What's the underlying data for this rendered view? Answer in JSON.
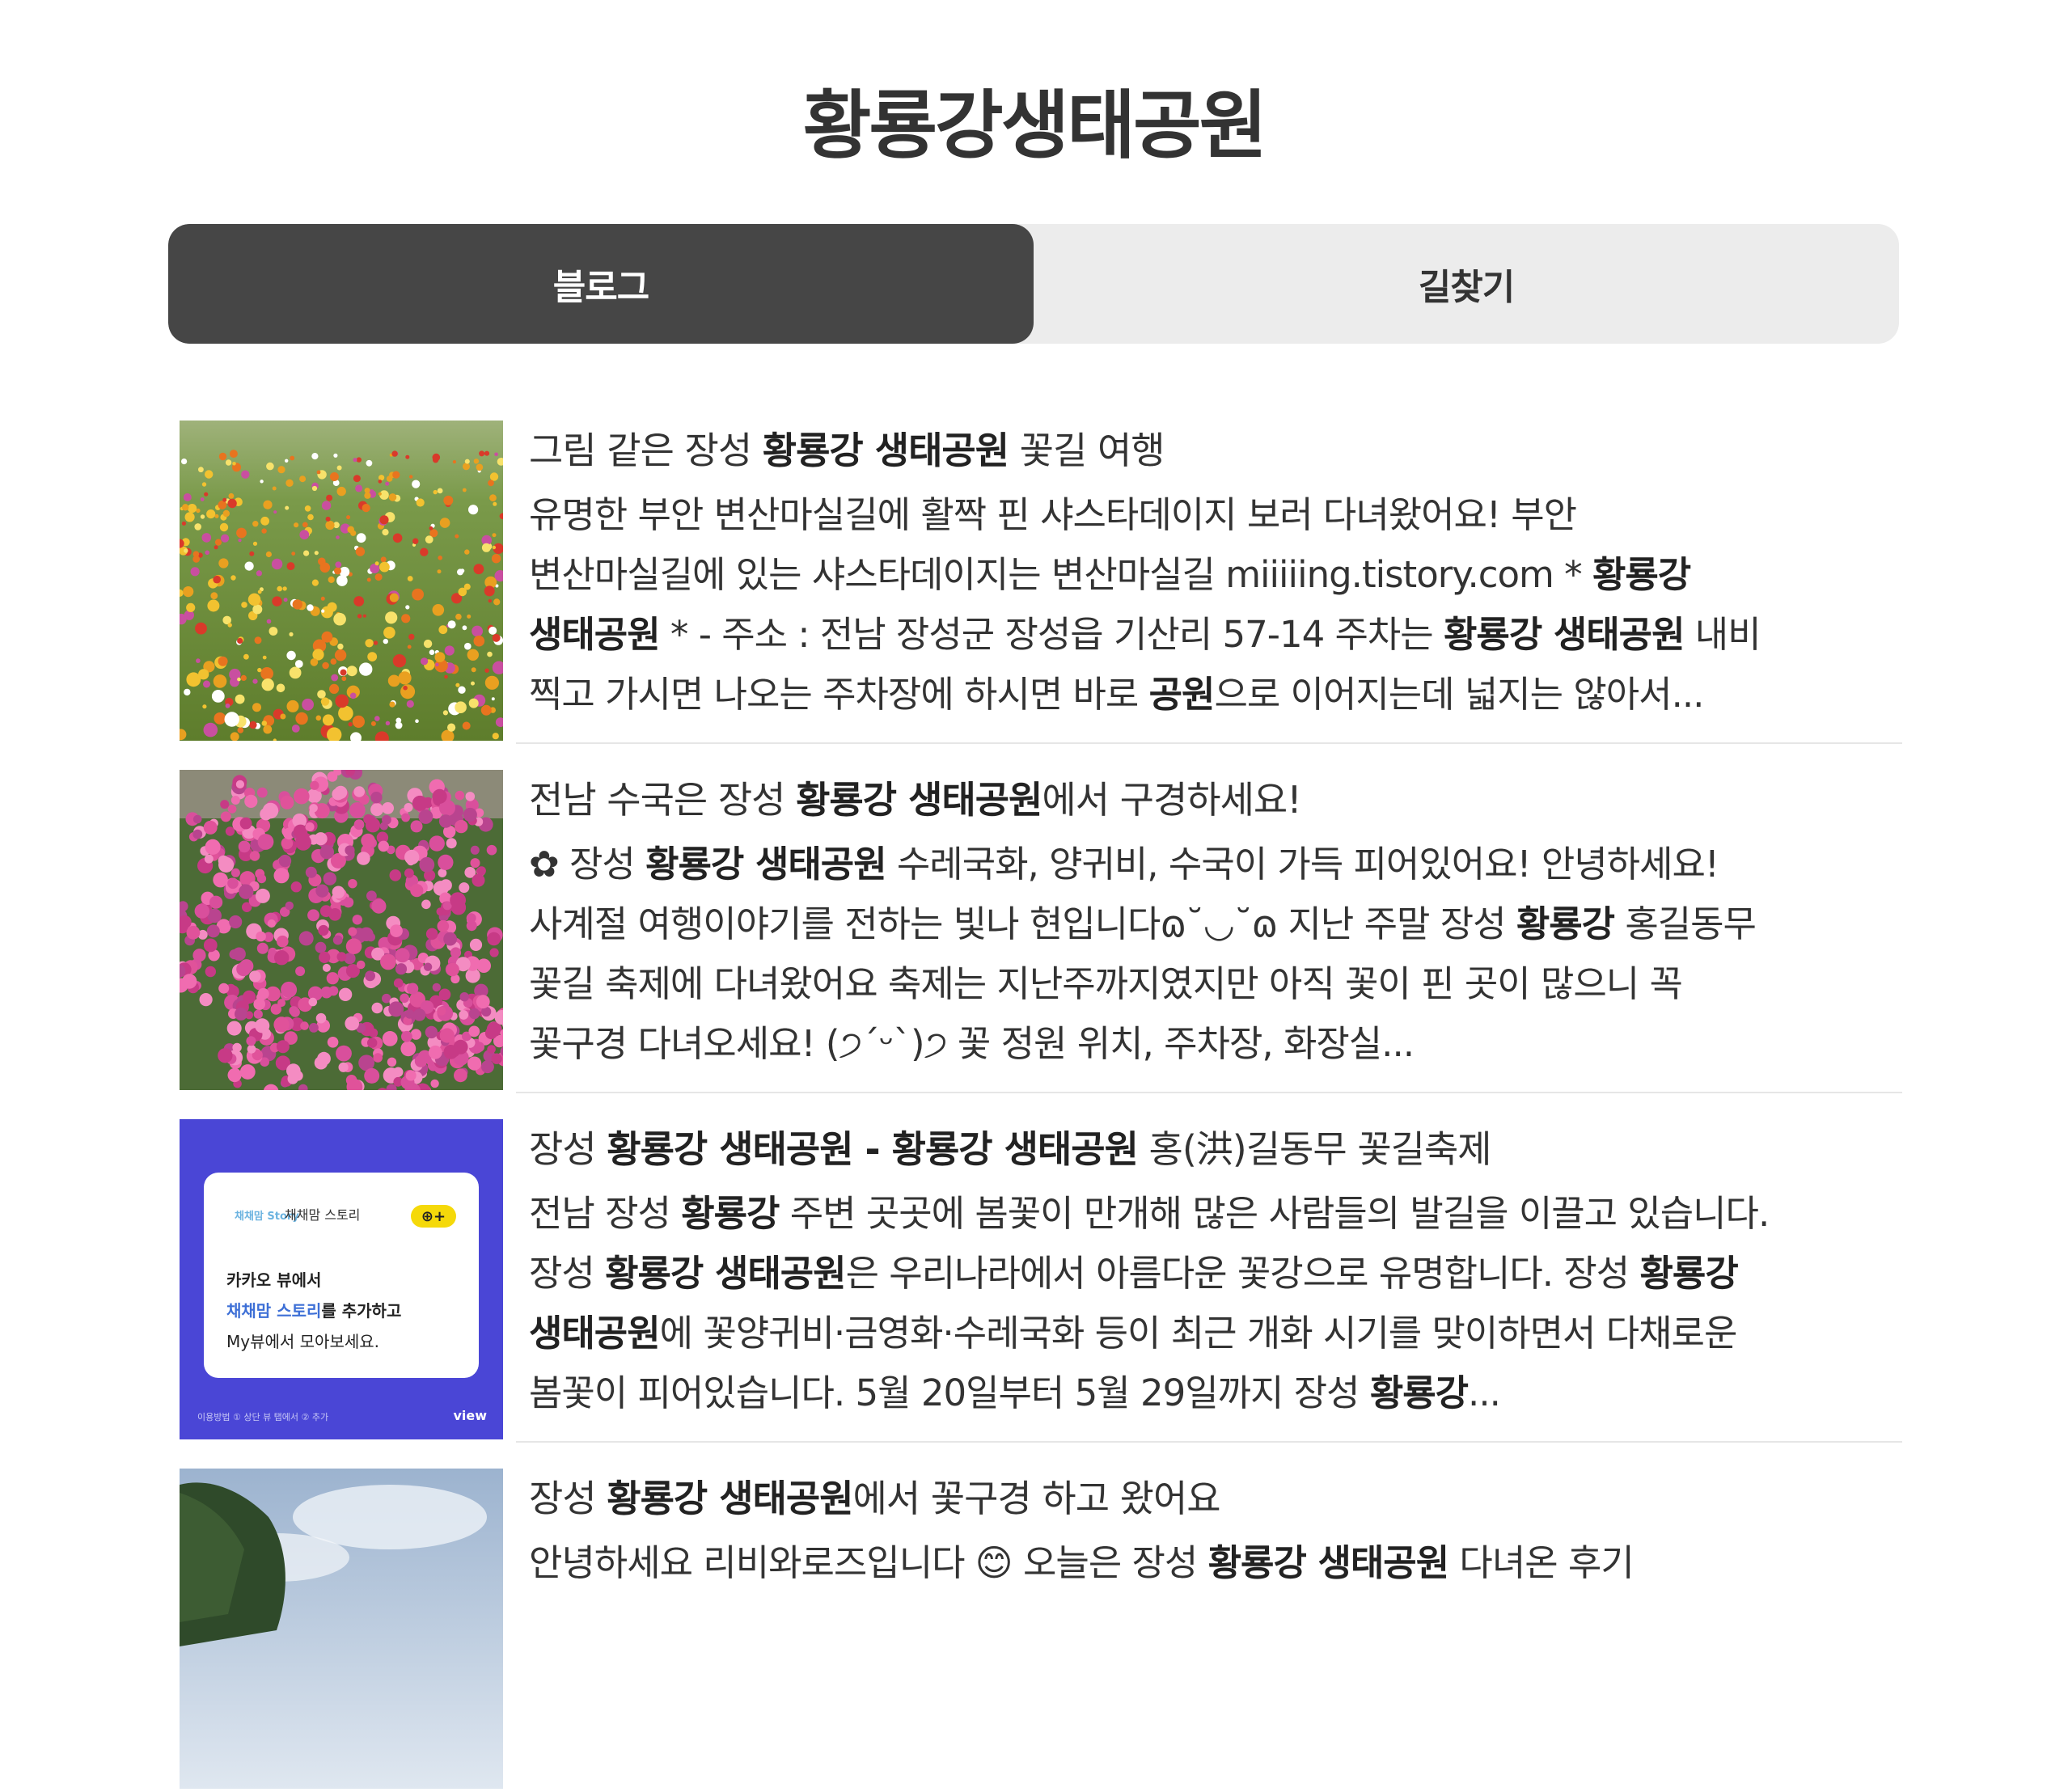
{
  "page": {
    "title": "황룡강생태공원"
  },
  "tabs": [
    {
      "label": "블로그",
      "active": true
    },
    {
      "label": "길찾기",
      "active": false
    }
  ],
  "results": [
    {
      "image": "flower-meadow-photo",
      "title": [
        {
          "t": "그림 같은 장성 ",
          "b": false
        },
        {
          "t": "황룡강 생태공원",
          "b": true
        },
        {
          "t": " 꽃길 여행",
          "b": false
        }
      ],
      "lines": [
        [
          {
            "t": "유명한 부안 변산마실길에 활짝 핀 샤스타데이지 보러 다녀왔어요! 부안",
            "b": false
          }
        ],
        [
          {
            "t": "변산마실길에 있는 샤스타데이지는 변산마실길 miiiiing.tistory.com * ",
            "b": false
          },
          {
            "t": "황룡강",
            "b": true
          }
        ],
        [
          {
            "t": "생태공원",
            "b": true
          },
          {
            "t": " * - 주소 : 전남 장성군 장성읍 기산리 57-14 주차는 ",
            "b": false
          },
          {
            "t": "황룡강 생태공원",
            "b": true
          },
          {
            "t": " 내비",
            "b": false
          }
        ],
        [
          {
            "t": "찍고 가시면 나오는 주차장에 하시면 바로 ",
            "b": false
          },
          {
            "t": "공원",
            "b": true
          },
          {
            "t": "으로 이어지는데 넓지는 않아서...",
            "b": false
          }
        ]
      ]
    },
    {
      "image": "hydrangea-photo",
      "title": [
        {
          "t": "전남 수국은 장성 ",
          "b": false
        },
        {
          "t": "황룡강 생태공원",
          "b": true
        },
        {
          "t": "에서 구경하세요!",
          "b": false
        }
      ],
      "lines": [
        [
          {
            "t": " ✿ 장성 ",
            "b": false
          },
          {
            "t": "황룡강 생태공원",
            "b": true
          },
          {
            "t": " 수레국화, 양귀비, 수국이 가득 피어있어요!   안녕하세요!",
            "b": false
          }
        ],
        [
          {
            "t": "사계절 여행이야기를 전하는 빛나 현입니다ɷ˘◡˘ɷ 지난 주말 장성 ",
            "b": false
          },
          {
            "t": "황룡강",
            "b": true
          },
          {
            "t": " 홍길동무",
            "b": false
          }
        ],
        [
          {
            "t": "꽃길 축제에 다녀왔어요 축제는 지난주까지였지만 아직 꽃이 핀 곳이 많으니 꼭",
            "b": false
          }
        ],
        [
          {
            "t": "꽃구경 다녀오세요! (੭ˊᵕˋ)੭  꽃 정원 위치, 주차장, 화장실...",
            "b": false
          }
        ]
      ]
    },
    {
      "image": "kakao-view-banner",
      "banner": {
        "brand": "채채맘 Story",
        "channel": "채채맘 스토리",
        "line1": "카카오 뷰에서",
        "line2_highlight": "채채맘 스토리",
        "line2_rest": "를 추가하고",
        "line3": "My뷰에서 모아보세요.",
        "footer": "이용방법 ① 상단 뷰 탭에서 ② 추가",
        "logo": "view"
      },
      "title": [
        {
          "t": "장성 ",
          "b": false
        },
        {
          "t": "황룡강 생태공원 - 황룡강 생태공원",
          "b": true
        },
        {
          "t": " 홍(洪)길동무 꽃길축제",
          "b": false
        }
      ],
      "lines": [
        [
          {
            "t": "전남 장성 ",
            "b": false
          },
          {
            "t": "황룡강",
            "b": true
          },
          {
            "t": " 주변 곳곳에 봄꽃이 만개해 많은 사람들의 발길을 이끌고 있습니다.",
            "b": false
          }
        ],
        [
          {
            "t": "장성 ",
            "b": false
          },
          {
            "t": "황룡강 생태공원",
            "b": true
          },
          {
            "t": "은 우리나라에서 아름다운 꽃강으로 유명합니다. 장성 ",
            "b": false
          },
          {
            "t": "황룡강",
            "b": true
          }
        ],
        [
          {
            "t": "생태공원",
            "b": true
          },
          {
            "t": "에 꽃양귀비·금영화·수레국화 등이 최근 개화 시기를 맞이하면서 다채로운",
            "b": false
          }
        ],
        [
          {
            "t": "봄꽃이 피어있습니다. 5월 20일부터 5월 29일까지 장성 ",
            "b": false
          },
          {
            "t": "황룡강",
            "b": true
          },
          {
            "t": "...",
            "b": false
          }
        ]
      ]
    },
    {
      "image": "sky-tree-photo",
      "title": [
        {
          "t": "장성 ",
          "b": false
        },
        {
          "t": "황룡강 생태공원",
          "b": true
        },
        {
          "t": "에서 꽃구경 하고 왔어요",
          "b": false
        }
      ],
      "lines": [
        [
          {
            "t": " 안녕하세요 리비와로즈입니다 😊 오늘은 장성 ",
            "b": false
          },
          {
            "t": "황룡강 생태공원",
            "b": true
          },
          {
            "t": " 다녀온 후기",
            "b": false
          }
        ]
      ]
    }
  ]
}
